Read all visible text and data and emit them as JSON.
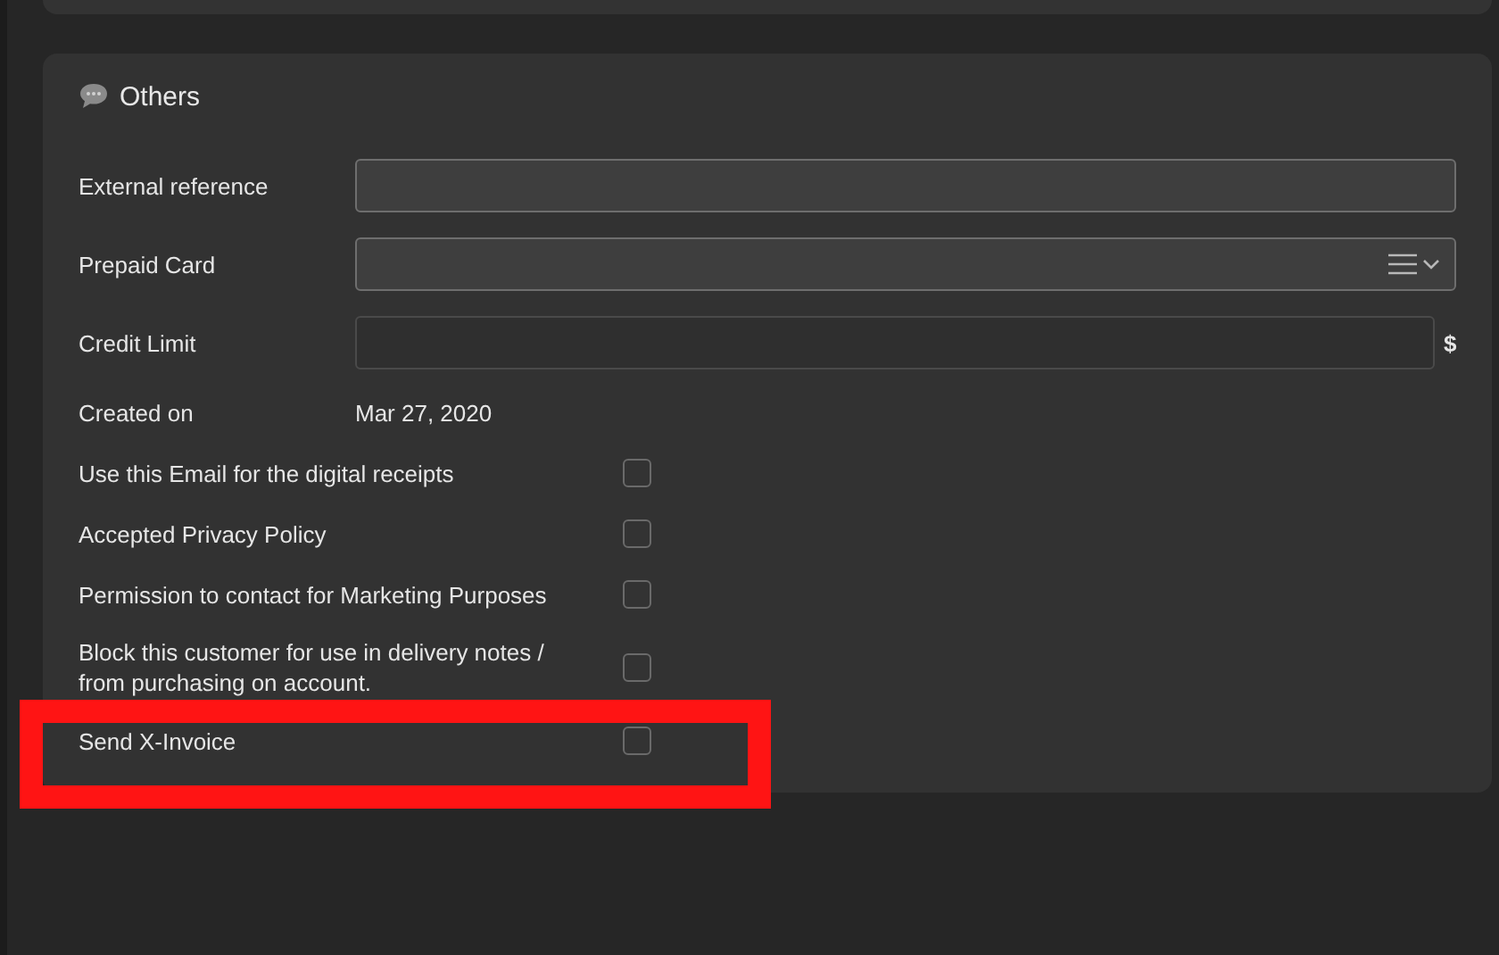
{
  "section": {
    "title": "Others"
  },
  "fields": [
    {
      "label": "External reference",
      "kind": "text",
      "disabled": false
    },
    {
      "label": "Prepaid Card",
      "kind": "select",
      "disabled": false
    },
    {
      "label": "Credit Limit",
      "kind": "currency",
      "unit": "$",
      "disabled": true
    }
  ],
  "created": {
    "label": "Created on",
    "value": "Mar 27, 2020"
  },
  "options": [
    {
      "label": "Use this Email for the digital receipts",
      "checked": false,
      "highlighted": false
    },
    {
      "label": "Accepted Privacy Policy",
      "checked": false,
      "highlighted": false
    },
    {
      "label": "Permission to contact for Marketing Purposes",
      "checked": false,
      "highlighted": false
    },
    {
      "label": "Block this customer for use in delivery notes / from purchasing on account.",
      "checked": false,
      "highlighted": false
    },
    {
      "label": "Send X-Invoice",
      "checked": false,
      "highlighted": true
    }
  ]
}
